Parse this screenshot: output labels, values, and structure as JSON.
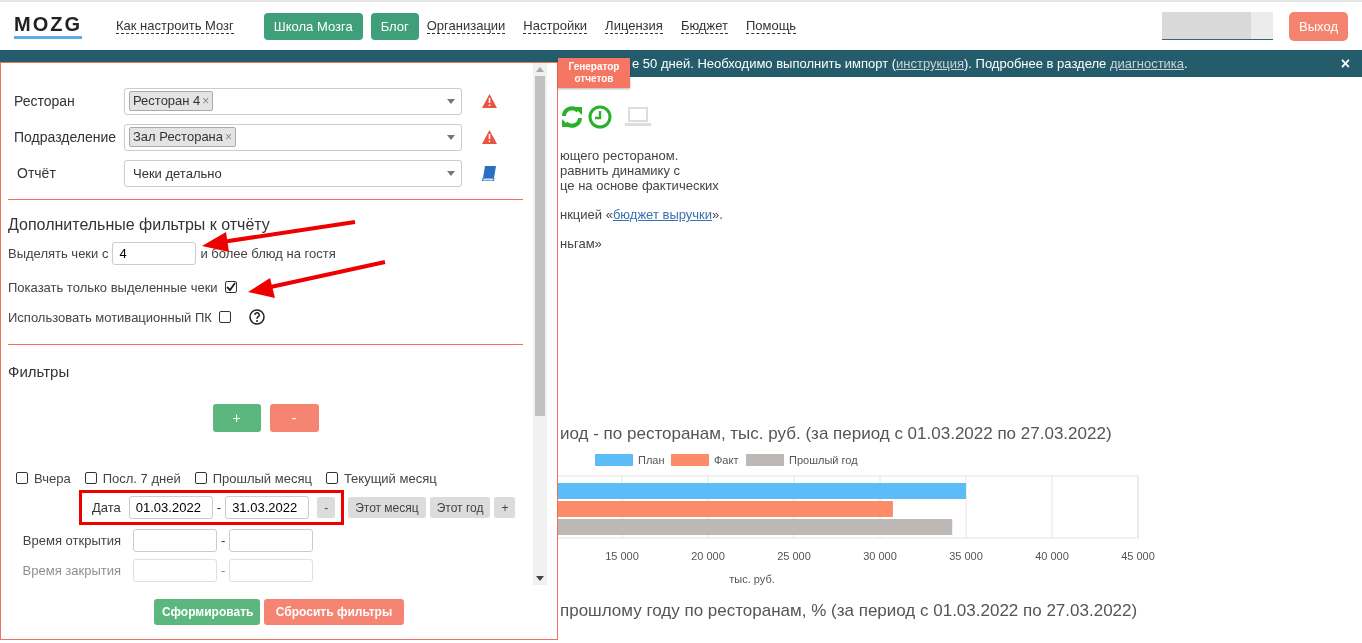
{
  "header": {
    "logo": "MOZG",
    "nav": [
      {
        "kind": "link",
        "label": "Как настроить Мозг"
      },
      {
        "kind": "button",
        "label": "Школа Мозга"
      },
      {
        "kind": "button",
        "label": "Блог"
      },
      {
        "kind": "link",
        "label": "Организации"
      },
      {
        "kind": "link",
        "label": "Настройки"
      },
      {
        "kind": "link",
        "label": "Лицензия"
      },
      {
        "kind": "link",
        "label": "Бюджет"
      },
      {
        "kind": "link",
        "label": "Помощь"
      }
    ],
    "logout": "Выход"
  },
  "banner": {
    "segments": [
      {
        "kind": "text",
        "text": "е 50 дней. Необходимо выполнить импорт ("
      },
      {
        "kind": "link",
        "text": "инструкция"
      },
      {
        "kind": "text",
        "text": "). Подробнее в разделе "
      },
      {
        "kind": "link",
        "text": "диагностика"
      },
      {
        "kind": "text",
        "text": "."
      }
    ],
    "close": "×"
  },
  "ribbon": "Генератор отчетов",
  "filter_panel": {
    "selects": [
      {
        "label": "Ресторан",
        "tag": "Ресторан 4",
        "tag_remove": "×"
      },
      {
        "label": "Подразделение",
        "tag": "Зал Ресторана",
        "tag_remove": "×"
      },
      {
        "label": "Отчёт",
        "value": "Чеки детально"
      }
    ],
    "extra_title": "Дополнительные фильтры к отчёту",
    "highlight_prefix": "Выделять чеки с",
    "highlight_value": "4",
    "highlight_suffix": "и более блюд на гостя",
    "options": [
      {
        "label": "Показать только выделенные чеки",
        "checked": true,
        "help": false
      },
      {
        "label": "Использовать мотивационный ПК",
        "checked": false,
        "help": true
      }
    ],
    "filters_title": "Фильтры",
    "add": "+",
    "remove": "-",
    "periods": [
      {
        "label": "Вчера",
        "checked": false
      },
      {
        "label": "Посл. 7 дней",
        "checked": false
      },
      {
        "label": "Прошлый месяц",
        "checked": false
      },
      {
        "label": "Текущий месяц",
        "checked": false
      }
    ],
    "date": {
      "label": "Дата",
      "from": "01.03.2022",
      "to": "31.03.2022",
      "separator": "-",
      "minus": "-",
      "quick": [
        "Этот месяц",
        "Этот год"
      ],
      "plus": "+"
    },
    "time_rows": [
      {
        "label": "Время открытия",
        "separator": "-"
      },
      {
        "label": "Время закрытия",
        "separator": "-"
      }
    ],
    "submit": "Сформировать",
    "reset": "Сбросить фильтры"
  },
  "content": {
    "description": [
      {
        "kind": "text",
        "text": "ющего рестораном."
      },
      {
        "kind": "text",
        "text": "равнить динамику с"
      },
      {
        "kind": "text",
        "text": "це на основе фактических"
      },
      {
        "kind": "gap"
      },
      {
        "kind": "link",
        "before": "нкцией «",
        "link": "бюджет выручки",
        "after": "»."
      },
      {
        "kind": "gap"
      },
      {
        "kind": "text",
        "text": "ньгам»"
      }
    ],
    "chart_title": "иод - по ресторанам, тыс. руб. (за период с 01.03.2022 по 27.03.2022)",
    "chart_data": {
      "type": "bar",
      "orientation": "horizontal",
      "grid": true,
      "legend": "top",
      "xlabel": "тыс. руб.",
      "xlim": [
        10000,
        45000
      ],
      "xticks": [
        {
          "value": 15000,
          "label": "15 000"
        },
        {
          "value": 20000,
          "label": "20 000"
        },
        {
          "value": 25000,
          "label": "25 000"
        },
        {
          "value": 30000,
          "label": "30 000"
        },
        {
          "value": 35000,
          "label": "35 000"
        },
        {
          "value": 40000,
          "label": "40 000"
        },
        {
          "value": 45000,
          "label": "45 000"
        }
      ],
      "series": [
        {
          "name": "План",
          "color": "#5bbcf8",
          "values": [
            35000
          ]
        },
        {
          "name": "Факт",
          "color": "#fc8c68",
          "values": [
            30750
          ]
        },
        {
          "name": "Прошлый год",
          "color": "#bdb8b6",
          "values": [
            34200
          ]
        }
      ]
    },
    "second_title": "прошлому году по ресторанам, % (за период с 01.03.2022 по 27.03.2022)"
  }
}
